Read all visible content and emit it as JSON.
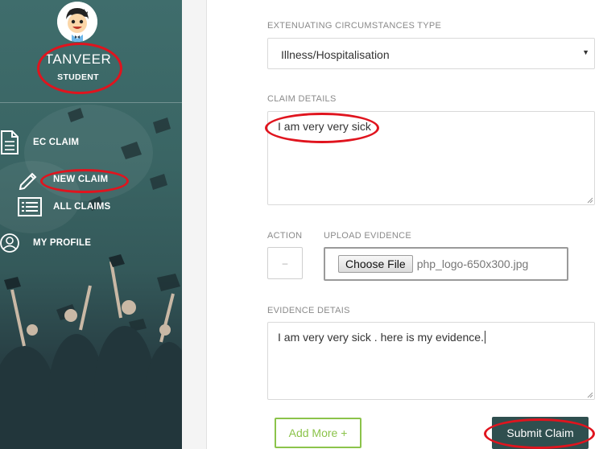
{
  "profile": {
    "name": "TANVEER",
    "role": "STUDENT"
  },
  "sidebar": {
    "items": [
      {
        "label": "EC CLAIM",
        "icon": "document-icon"
      },
      {
        "label": "NEW CLAIM",
        "icon": "pencil-icon"
      },
      {
        "label": "ALL CLAIMS",
        "icon": "list-icon"
      },
      {
        "label": "MY PROFILE",
        "icon": "user-icon"
      }
    ]
  },
  "form": {
    "ec_type_label": "EXTENUATING CIRCUMSTANCES TYPE",
    "ec_type_value": "Illness/Hospitalisation",
    "claim_details_label": "CLAIM DETAILS",
    "claim_details_value": "I am very very sick",
    "action_label": "ACTION",
    "action_value": "–",
    "upload_label": "UPLOAD EVIDENCE",
    "choose_file_label": "Choose File",
    "file_name": "php_logo-650x300.jpg",
    "evidence_details_label": "EVIDENCE DETAIS",
    "evidence_details_value": "I am very very sick . here is my evidence."
  },
  "buttons": {
    "add_more": "Add More +",
    "submit": "Submit Claim"
  },
  "colors": {
    "sidebar": "#3a6564",
    "submit_bg": "#2f4f4f",
    "add_more": "#8bc34a",
    "annotation_red": "#e0141e"
  }
}
